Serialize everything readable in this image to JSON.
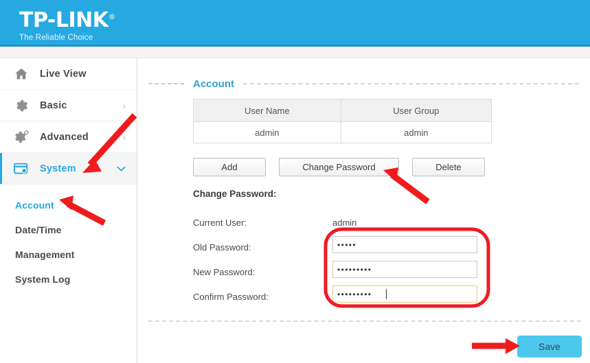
{
  "header": {
    "brand": "TP-LINK",
    "registered_mark": "®",
    "tagline": "The Reliable Choice"
  },
  "sidebar": {
    "items": [
      {
        "label": "Live View",
        "icon": "home-icon",
        "arrow": "",
        "active": false
      },
      {
        "label": "Basic",
        "icon": "gear-icon",
        "arrow": "›",
        "active": false
      },
      {
        "label": "Advanced",
        "icon": "gear-advanced-icon",
        "arrow": "›",
        "active": false
      },
      {
        "label": "System",
        "icon": "system-window-icon",
        "arrow": "⌄",
        "active": true
      }
    ],
    "subitems": [
      {
        "label": "Account",
        "active": true
      },
      {
        "label": "Date/Time",
        "active": false
      },
      {
        "label": "Management",
        "active": false
      },
      {
        "label": "System Log",
        "active": false
      }
    ]
  },
  "main": {
    "section_title": "Account",
    "table": {
      "headers": [
        "User Name",
        "User Group"
      ],
      "rows": [
        [
          "admin",
          "admin"
        ]
      ]
    },
    "buttons": {
      "add": "Add",
      "change_password": "Change Password",
      "delete": "Delete"
    },
    "change_password_heading": "Change Password:",
    "fields": [
      {
        "label": "Current User:",
        "value": "admin",
        "type": "text"
      },
      {
        "label": "Old Password:",
        "value": "•••••",
        "type": "password",
        "focused": false
      },
      {
        "label": "New Password:",
        "value": "•••••••••",
        "type": "password",
        "focused": false
      },
      {
        "label": "Confirm Password:",
        "value": "•••••••••",
        "type": "password",
        "focused": true
      }
    ],
    "save_label": "Save"
  },
  "annotations": {
    "color": "#ee1c1c",
    "highlight_color": "#ee1c25",
    "arrows": [
      {
        "name": "arrow-to-system",
        "target": "System"
      },
      {
        "name": "arrow-to-account",
        "target": "Account"
      },
      {
        "name": "arrow-to-change-password",
        "target": "Change Password"
      },
      {
        "name": "arrow-to-save",
        "target": "Save"
      }
    ],
    "highlight_box": {
      "name": "password-fields-highlight",
      "target": "password inputs"
    }
  },
  "colors": {
    "header_blue": "#26a9e0",
    "accent_blue": "#26a9e0",
    "save_button": "#4ec7ec",
    "annotation_red": "#ee1c1c"
  }
}
